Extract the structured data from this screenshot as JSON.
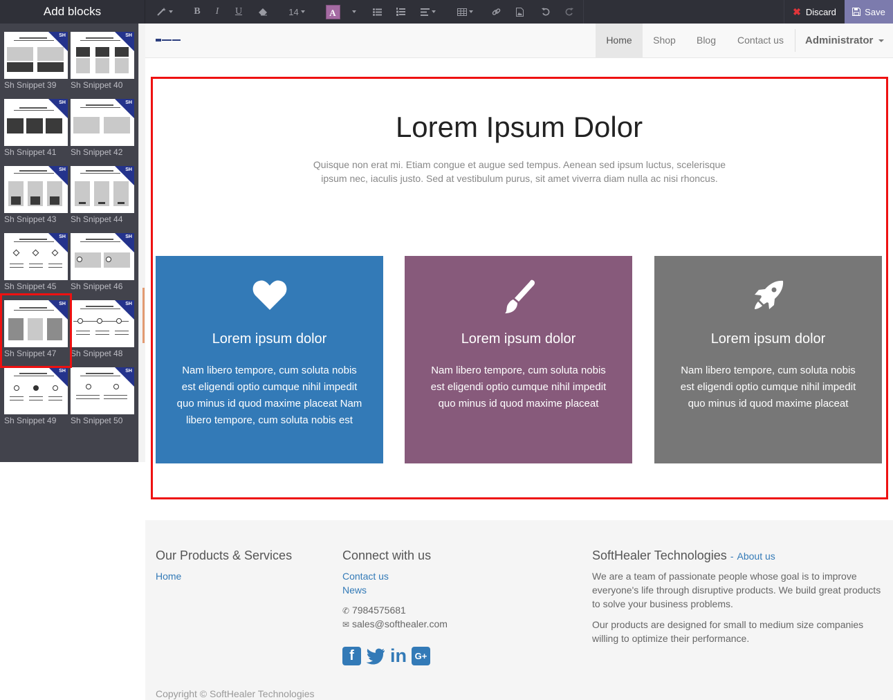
{
  "editor": {
    "add_blocks_title": "Add blocks",
    "font_size": "14",
    "color_letter": "A",
    "discard_label": "Discard",
    "save_label": "Save",
    "colors": {
      "bar": "#2f3038",
      "save": "#7c7bad",
      "discard_x": "#e0353a"
    }
  },
  "snippets": [
    {
      "label": "Sh Snippet 39"
    },
    {
      "label": "Sh Snippet 40"
    },
    {
      "label": "Sh Snippet 41"
    },
    {
      "label": "Sh Snippet 42"
    },
    {
      "label": "Sh Snippet 43"
    },
    {
      "label": "Sh Snippet 44"
    },
    {
      "label": "Sh Snippet 45"
    },
    {
      "label": "Sh Snippet 46"
    },
    {
      "label": "Sh Snippet 47",
      "selected": true
    },
    {
      "label": "Sh Snippet 48"
    },
    {
      "label": "Sh Snippet 49"
    },
    {
      "label": "Sh Snippet 50"
    }
  ],
  "snippet_badge": "SH",
  "nav": {
    "items": [
      "Home",
      "Shop",
      "Blog",
      "Contact us"
    ],
    "active": "Home",
    "user": "Administrator"
  },
  "hero": {
    "title": "Lorem Ipsum Dolor",
    "subtitle": "Quisque non erat mi. Etiam congue et augue sed tempus. Aenean sed ipsum luctus, scelerisque ipsum nec, iaculis justo. Sed at vestibulum purus, sit amet viverra diam nulla ac nisi rhoncus."
  },
  "features": [
    {
      "icon": "heart-icon",
      "color": "#337ab7",
      "title": "Lorem ipsum dolor",
      "text": "Nam libero tempore, cum soluta nobis est eligendi optio cumque nihil impedit quo minus id quod maxime placeat Nam libero tempore, cum soluta nobis est"
    },
    {
      "icon": "paintbrush-icon",
      "color": "#875a7b",
      "title": "Lorem ipsum dolor",
      "text": "Nam libero tempore, cum soluta nobis est eligendi optio cumque nihil impedit quo minus id quod maxime placeat"
    },
    {
      "icon": "rocket-icon",
      "color": "#777777",
      "title": "Lorem ipsum dolor",
      "text": "Nam libero tempore, cum soluta nobis est eligendi optio cumque nihil impedit quo minus id quod maxime placeat"
    }
  ],
  "footer": {
    "products_heading": "Our Products & Services",
    "products_links": [
      "Home"
    ],
    "connect_heading": "Connect with us",
    "connect_links": [
      "Contact us",
      "News"
    ],
    "phone": "7984575681",
    "email": "sales@softhealer.com",
    "company_heading": "SoftHealer Technologies",
    "about_link": "About us",
    "about_dash": "-",
    "about_p1": "We are a team of passionate people whose goal is to improve everyone's life through disruptive products. We build great products to solve your business problems.",
    "about_p2": "Our products are designed for small to medium size companies willing to optimize their performance.",
    "social": [
      "facebook-icon",
      "twitter-icon",
      "linkedin-icon",
      "google-plus-icon"
    ],
    "copyright": "Copyright © SoftHealer Technologies"
  }
}
